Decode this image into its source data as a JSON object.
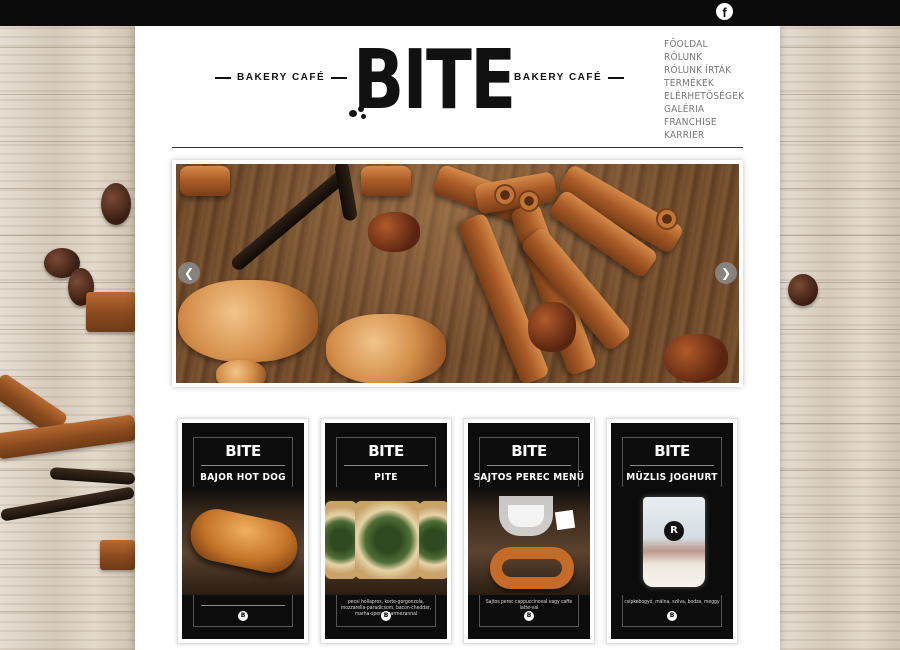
{
  "topbar": {
    "social": [
      {
        "name": "facebook-icon",
        "glyph": "f"
      }
    ]
  },
  "header": {
    "tagline_left": "BAKERY CAFÉ",
    "tagline_right": "BAKERY CAFÉ",
    "logo": "BITE"
  },
  "nav": {
    "items": [
      {
        "label": "FŐOLDAL"
      },
      {
        "label": "RÓLUNK"
      },
      {
        "label": "RÓLUNK ÍRTÁK"
      },
      {
        "label": "TERMÉKEK"
      },
      {
        "label": "ELÉRHETŐSÉGEK"
      },
      {
        "label": "GALÉRIA"
      },
      {
        "label": "FRANCHISE"
      },
      {
        "label": "KARRIER"
      }
    ]
  },
  "slider": {
    "prev": "❮",
    "next": "❯"
  },
  "products": [
    {
      "logo": "BITE",
      "title": "BAJOR HOT DOG",
      "subtitle": "",
      "badge": "B"
    },
    {
      "logo": "BITE",
      "title": "PITE",
      "subtitle": "pecsi hollapros, korte-gorgonzola, mozzarella-paradicsom, bacon-cheddar, marha-spenot parmezannal",
      "badge": "B"
    },
    {
      "logo": "BITE",
      "title": "SAJTOS PEREC MENÜ",
      "subtitle": "Sajtos perec cappuccinoval vagy caffe latte-val",
      "badge": "B"
    },
    {
      "logo": "BITE",
      "title": "MÜZLIS JOGHURT",
      "subtitle": "csipkebogyó, málna, szilva, bodza, meggy",
      "badge": "B"
    }
  ],
  "colors": {
    "topbar": "#0b0b0b",
    "page_bg": "#ffffff",
    "nav_text": "#777777",
    "card_bg": "#0c0c0c"
  }
}
